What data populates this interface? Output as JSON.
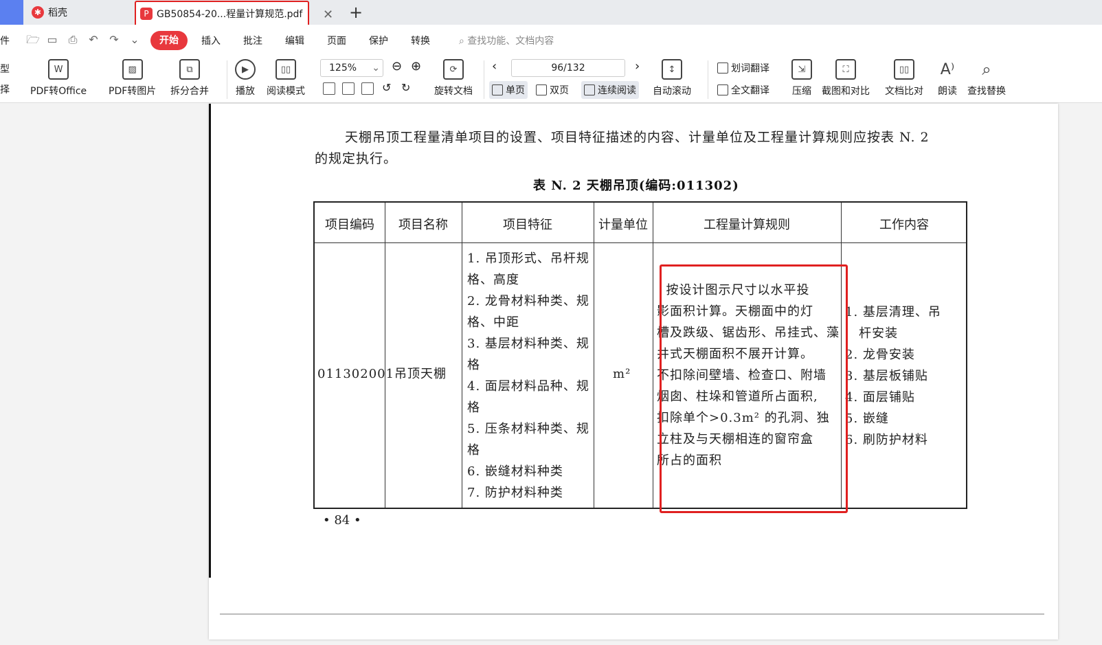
{
  "tabs": {
    "home_label": "稻壳",
    "pdf_label": "GB50854-20...程量计算规范.pdf",
    "add": "+"
  },
  "menubar": {
    "left_cut": "件",
    "items": [
      "开始",
      "插入",
      "批注",
      "编辑",
      "页面",
      "保护",
      "转换"
    ],
    "search_placeholder": "查找功能、文档内容"
  },
  "ribbon": {
    "left_cut_top": "型",
    "left_cut_bottom": "择",
    "pdf_to_office": "PDF转Office",
    "pdf_to_image": "PDF转图片",
    "split_merge": "拆分合并",
    "play": "播放",
    "read_mode": "阅读模式",
    "zoom": "125%",
    "rotate": "旋转文档",
    "page_indicator": "96/132",
    "single_page": "单页",
    "double_page": "双页",
    "continuous": "连续阅读",
    "auto_scroll": "自动滚动",
    "word_translate": "划词翻译",
    "full_translate": "全文翻译",
    "compress": "压缩",
    "screenshot_compare": "截图和对比",
    "doc_compare": "文档比对",
    "read_aloud": "朗读",
    "find_replace": "查找替换"
  },
  "document": {
    "para_line1": "天棚吊顶工程量清单项目的设置、项目特征描述的内容、计量单位及工程量计算规则应按表 N. 2",
    "para_line2": "的规定执行。",
    "table_caption": "表 N. 2    天棚吊顶(编码:011302)",
    "headers": [
      "项目编码",
      "项目名称",
      "项目特征",
      "计量单位",
      "工程量计算规则",
      "工作内容"
    ],
    "row": {
      "code": "011302001",
      "name": "吊顶天棚",
      "features": [
        "1. 吊顶形式、吊杆规",
        "格、高度",
        "2. 龙骨材料种类、规",
        "格、中距",
        "3. 基层材料种类、规",
        "格",
        "4. 面层材料品种、规",
        "格",
        "5. 压条材料种类、规",
        "格",
        "6. 嵌缝材料种类",
        "7. 防护材料种类"
      ],
      "unit": "m²",
      "rule": [
        "  按设计图示尺寸以水平投",
        "影面积计算。天棚面中的灯",
        "槽及跌级、锯齿形、吊挂式、藻",
        "井式天棚面积不展开计算。",
        "不扣除间壁墙、检查口、附墙",
        "烟囱、柱垛和管道所占面积,",
        "扣除单个>0.3m² 的孔洞、独",
        "立柱及与天棚相连的窗帘盒",
        "所占的面积"
      ],
      "work": [
        "1. 基层清理、吊",
        "   杆安装",
        "2. 龙骨安装",
        "3. 基层板铺贴",
        "4. 面层铺贴",
        "5. 嵌缝",
        "6. 刷防护材料"
      ]
    },
    "page_number": "• 84 •"
  }
}
